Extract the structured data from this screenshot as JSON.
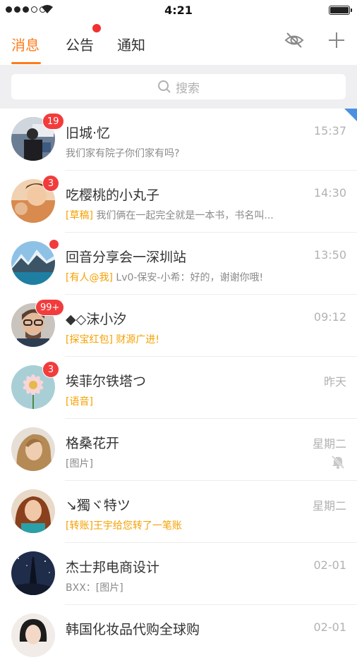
{
  "status_bar": {
    "time": "4:21"
  },
  "tabs": [
    {
      "label": "消息",
      "active": true
    },
    {
      "label": "公告",
      "has_dot": true
    },
    {
      "label": "通知"
    }
  ],
  "header_icons": [
    "eye-off-icon",
    "plus-icon"
  ],
  "search": {
    "placeholder": "搜索"
  },
  "conversations": [
    {
      "name": "旧城·忆",
      "time": "15:37",
      "tag": "",
      "preview": "我们家有院子你们家有吗?",
      "badge": "19",
      "pinned": true
    },
    {
      "name": "吃樱桃的小丸子",
      "time": "14:30",
      "tag": "[草稿]",
      "preview": "我们俩在一起完全就是一本书，书名叫...",
      "badge": "3"
    },
    {
      "name": "回音分享会一深圳站",
      "time": "13:50",
      "tag": "[有人@我]",
      "preview": "Lv0-保安-小希：好的，谢谢你哦!",
      "dot": true
    },
    {
      "name": "◆◇沫小汐",
      "time": "09:12",
      "tag": "[探宝红包]",
      "preview": "财源广进!",
      "badge": "99+"
    },
    {
      "name": "埃菲尔铁塔つ",
      "time": "昨天",
      "tag": "[语音]",
      "preview": "",
      "badge": "3"
    },
    {
      "name": "格桑花开",
      "time": "星期二",
      "tag": "",
      "preview": "[图片]",
      "muted": true
    },
    {
      "name": "↘獨ヾ特ツ",
      "time": "星期二",
      "tag": "[转账]",
      "preview": "王宇给您转了一笔账",
      "tag_full_yellow": true
    },
    {
      "name": "杰士邦电商设计",
      "time": "02-01",
      "tag": "",
      "preview": "BXX：[图片]"
    },
    {
      "name": "韩国化妆品代购全球购",
      "time": "02-01",
      "tag": "",
      "preview": ""
    }
  ],
  "colors": {
    "accent": "#ff7b1a",
    "badge": "#f23c3c",
    "tag": "#f5a100"
  }
}
